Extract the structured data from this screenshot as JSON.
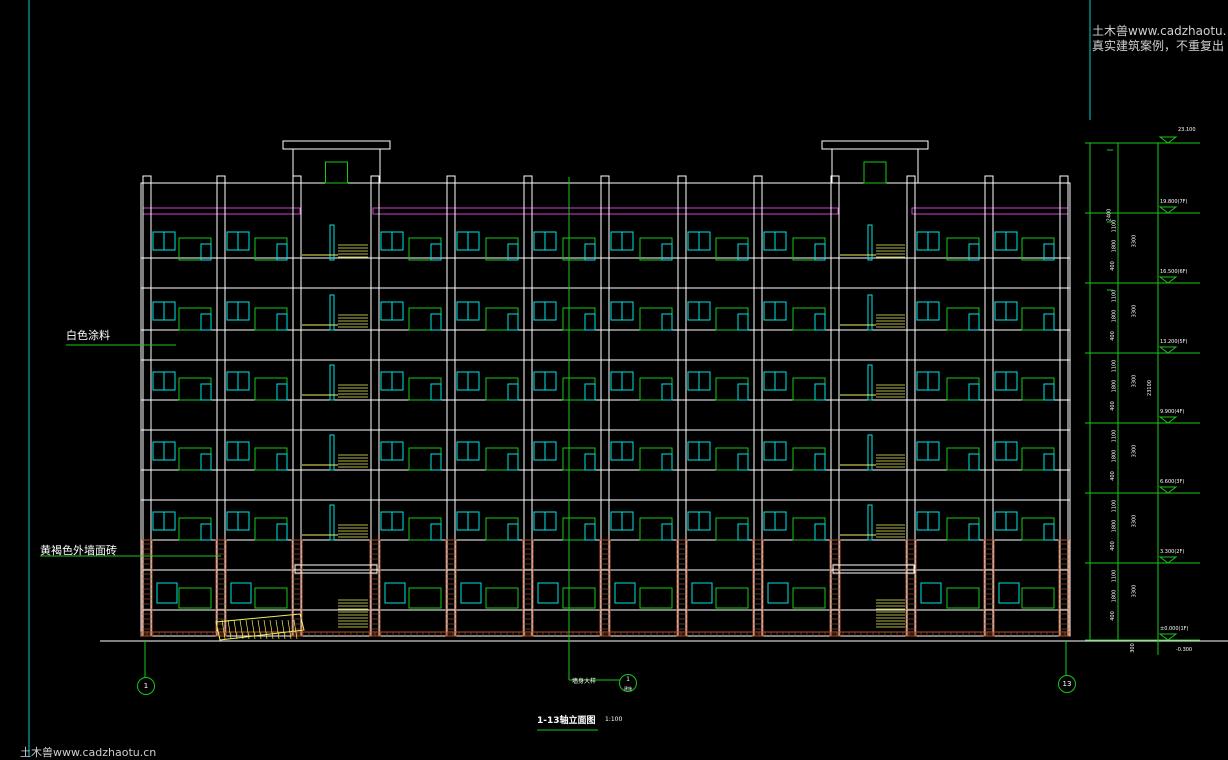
{
  "watermark": {
    "top_line1": "土木兽www.cadzhaotu.",
    "top_line2": "真实建筑案例，不重复出",
    "bottom": "土木兽www.cadzhaotu.cn"
  },
  "labels": {
    "white_paint": "白色涂料",
    "brown_tile": "黄褐色外墙面砖",
    "ref_note": "墙身大样"
  },
  "drawing": {
    "title": "1-13轴立面图",
    "scale": "1:100"
  },
  "axis_marks": {
    "left": "1",
    "right": "13",
    "detail_top": "1",
    "detail_bottom": "建施"
  },
  "dimension": {
    "total_height": "23100",
    "top_level": "23.100",
    "bottom_level": "-0.300",
    "base_dim": "300",
    "floor_heights": [
      "3300",
      "3300",
      "3300",
      "3300",
      "3300",
      "3300"
    ],
    "segments": [
      "1100",
      "1800",
      "400"
    ],
    "parapet": "2400",
    "levels": [
      "19.800(7F)",
      "16.500(6F)",
      "13.200(5F)",
      "9.900(4F)",
      "6.600(3F)",
      "3.300(2F)",
      "±0.000(1F)"
    ]
  },
  "colors": {
    "background": "#000000",
    "outline": "#ffffff",
    "window": "#00e5e5",
    "frame": "#17c817",
    "brick": "#b4502a",
    "parapet_band": "#d040d0",
    "stair": "#f0f060",
    "frame_border": "#00cccc"
  }
}
